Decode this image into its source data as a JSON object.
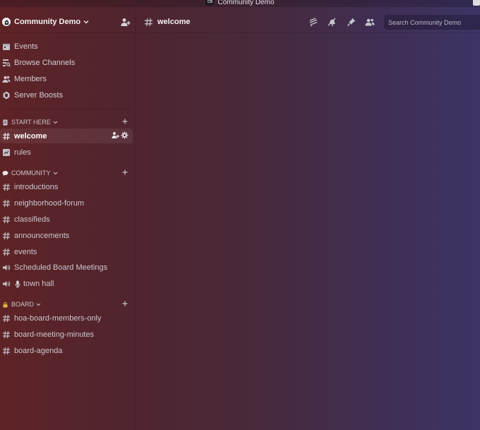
{
  "window": {
    "title": "Community Demo",
    "app_badge": "CB"
  },
  "server": {
    "name": "Community Demo"
  },
  "nav": [
    {
      "label": "Events",
      "icon": "calendar-icon"
    },
    {
      "label": "Browse Channels",
      "icon": "browse-channels-icon"
    },
    {
      "label": "Members",
      "icon": "members-icon"
    },
    {
      "label": "Server Boosts",
      "icon": "boost-icon"
    }
  ],
  "categories": {
    "start_here": {
      "label": "START HERE"
    },
    "community": {
      "label": "COMMUNITY"
    },
    "board": {
      "label": "BOARD"
    }
  },
  "channels": {
    "welcome": "welcome",
    "rules": "rules",
    "introductions": "introductions",
    "neighborhood_forum": "neighborhood-forum",
    "classifieds": "classifieds",
    "announcements": "announcements",
    "events": "events",
    "scheduled_board_meetings": "Scheduled Board Meetings",
    "town_hall": "town hall",
    "hoa_board_members_only": "hoa-board-members-only",
    "board_meeting_minutes": "board-meeting-minutes",
    "board_agenda": "board-agenda"
  },
  "header": {
    "channel_title": "welcome",
    "search_placeholder": "Search Community Demo"
  },
  "colors": {
    "active_channel_bg": "rgba(255,255,255,0.07)",
    "text_primary": "#f2f2f4"
  }
}
